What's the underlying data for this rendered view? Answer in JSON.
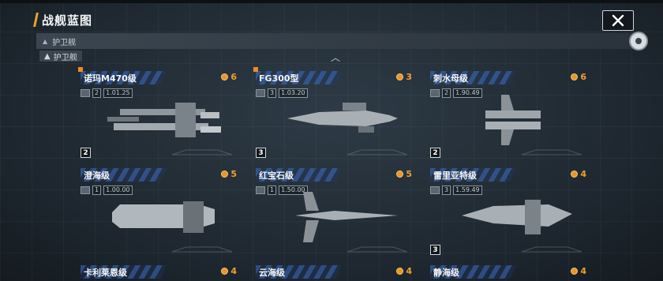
{
  "header": {
    "title": "战舰蓝图"
  },
  "filter": {
    "selected": "护卫舰",
    "tag": "护卫舰"
  },
  "colors": {
    "accent": "#f0a030",
    "header_stripe": "#3c6ec8",
    "coin": "#e8962a",
    "corner": "#f08a24"
  },
  "cards": [
    {
      "name": "诺玛M470级",
      "cost": "6",
      "stat_num": "2",
      "stat_val": "1.01.25",
      "level": "2"
    },
    {
      "name": "FG300型",
      "cost": "3",
      "stat_num": "3",
      "stat_val": "1.03.20",
      "level": "3"
    },
    {
      "name": "刺水母级",
      "cost": "6",
      "stat_num": "2",
      "stat_val": "1.90.49",
      "level": "2"
    },
    {
      "name": "澄海级",
      "cost": "5",
      "stat_num": "1",
      "stat_val": "1.00.00"
    },
    {
      "name": "红宝石级",
      "cost": "5",
      "stat_num": "1",
      "stat_val": "1.50.00"
    },
    {
      "name": "雷里亚特级",
      "cost": "4",
      "stat_num": "3",
      "stat_val": "1.59.49",
      "level": "3"
    },
    {
      "name": "卡利莱恩级",
      "cost": "4"
    },
    {
      "name": "云海级",
      "cost": "4"
    },
    {
      "name": "静海级",
      "cost": "4"
    }
  ]
}
